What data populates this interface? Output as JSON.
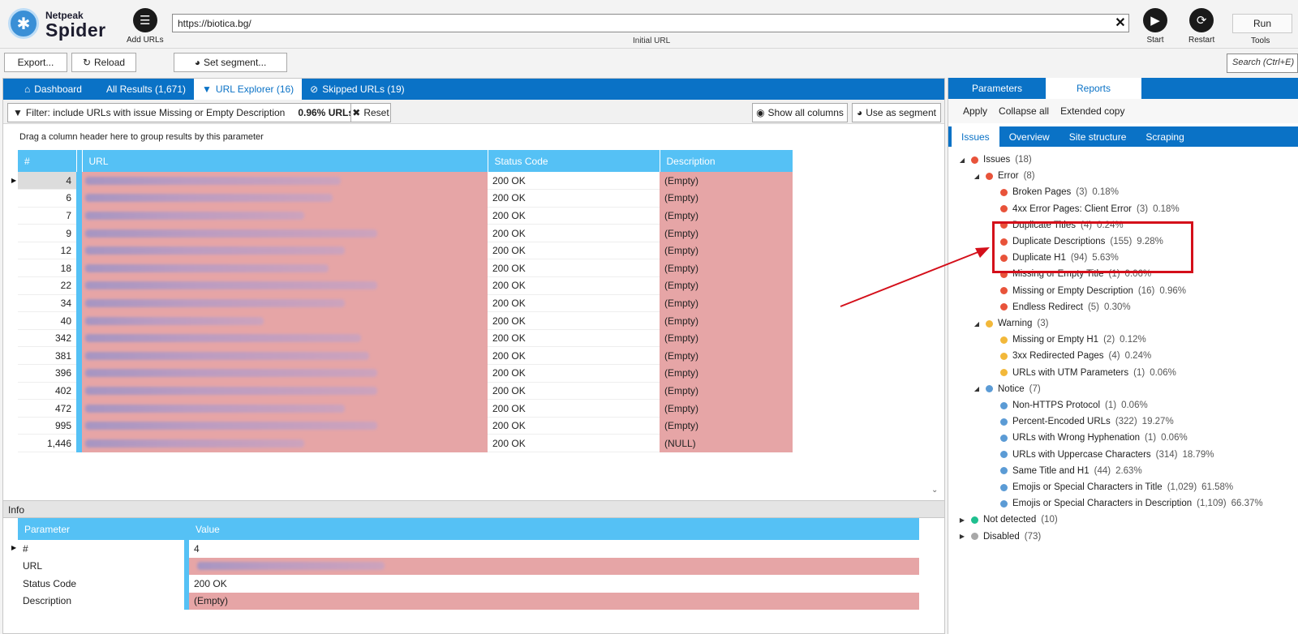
{
  "app": {
    "logo_small": "Netpeak",
    "logo_big": "Spider"
  },
  "toolbar": {
    "add_urls_label": "Add URLs",
    "url_value": "https://biotica.bg/",
    "url_caption": "Initial URL",
    "start_label": "Start",
    "restart_label": "Restart",
    "run_label": "Run",
    "tools_label": "Tools",
    "export_label": "Export...",
    "reload_label": "Reload",
    "segment_label": "Set segment...",
    "search_placeholder": "Search (Ctrl+E)"
  },
  "tabs": {
    "dashboard": "Dashboard",
    "all_results": "All Results (1,671)",
    "url_explorer": "URL Explorer (16)",
    "skipped": "Skipped URLs (19)"
  },
  "filter": {
    "text": "Filter: include URLs with issue Missing or Empty Description",
    "pct": "0.96% URLs",
    "reset_label": "Reset",
    "show_all_columns": "Show all columns",
    "use_as_segment": "Use as segment"
  },
  "grid": {
    "group_hint": "Drag a column header here to group results by this parameter",
    "col_num": "#",
    "col_url": "URL",
    "col_status": "Status Code",
    "col_desc": "Description",
    "rows": [
      {
        "num": "4",
        "status": "200 OK",
        "desc": "(Empty)",
        "w": 0.63
      },
      {
        "num": "6",
        "status": "200 OK",
        "desc": "(Empty)",
        "w": 0.61
      },
      {
        "num": "7",
        "status": "200 OK",
        "desc": "(Empty)",
        "w": 0.54
      },
      {
        "num": "9",
        "status": "200 OK",
        "desc": "(Empty)",
        "w": 0.72
      },
      {
        "num": "12",
        "status": "200 OK",
        "desc": "(Empty)",
        "w": 0.64
      },
      {
        "num": "18",
        "status": "200 OK",
        "desc": "(Empty)",
        "w": 0.6
      },
      {
        "num": "22",
        "status": "200 OK",
        "desc": "(Empty)",
        "w": 0.72
      },
      {
        "num": "34",
        "status": "200 OK",
        "desc": "(Empty)",
        "w": 0.64
      },
      {
        "num": "40",
        "status": "200 OK",
        "desc": "(Empty)",
        "w": 0.44
      },
      {
        "num": "342",
        "status": "200 OK",
        "desc": "(Empty)",
        "w": 0.68
      },
      {
        "num": "381",
        "status": "200 OK",
        "desc": "(Empty)",
        "w": 0.7
      },
      {
        "num": "396",
        "status": "200 OK",
        "desc": "(Empty)",
        "w": 0.72
      },
      {
        "num": "402",
        "status": "200 OK",
        "desc": "(Empty)",
        "w": 0.72
      },
      {
        "num": "472",
        "status": "200 OK",
        "desc": "(Empty)",
        "w": 0.64
      },
      {
        "num": "995",
        "status": "200 OK",
        "desc": "(Empty)",
        "w": 0.72
      },
      {
        "num": "1,446",
        "status": "200 OK",
        "desc": "(NULL)",
        "w": 0.54
      }
    ]
  },
  "info": {
    "title": "Info",
    "col_param": "Parameter",
    "col_value": "Value",
    "rows": [
      {
        "param": "#",
        "value": "4"
      },
      {
        "param": "URL",
        "value": ""
      },
      {
        "param": "Status Code",
        "value": "200 OK"
      },
      {
        "param": "Description",
        "value": "(Empty)"
      }
    ]
  },
  "right": {
    "tab_parameters": "Parameters",
    "tab_reports": "Reports",
    "apply": "Apply",
    "collapse_all": "Collapse all",
    "extended_copy": "Extended copy",
    "subtabs": [
      "Issues",
      "Overview",
      "Site structure",
      "Scraping"
    ],
    "tree": [
      {
        "level": 0,
        "toggle": "◢",
        "color": "#e8533a",
        "label": "Issues",
        "count": "(18)",
        "pct": ""
      },
      {
        "level": 1,
        "toggle": "◢",
        "color": "#e8533a",
        "label": "Error",
        "count": "(8)",
        "pct": ""
      },
      {
        "level": 2,
        "toggle": "",
        "color": "#e8533a",
        "label": "Broken Pages",
        "count": "(3)",
        "pct": "0.18%"
      },
      {
        "level": 2,
        "toggle": "",
        "color": "#e8533a",
        "label": "4xx Error Pages: Client Error",
        "count": "(3)",
        "pct": "0.18%"
      },
      {
        "level": 2,
        "toggle": "",
        "color": "#e8533a",
        "label": "Duplicate Titles",
        "count": "(4)",
        "pct": "0.24%"
      },
      {
        "level": 2,
        "toggle": "",
        "color": "#e8533a",
        "label": "Duplicate Descriptions",
        "count": "(155)",
        "pct": "9.28%"
      },
      {
        "level": 2,
        "toggle": "",
        "color": "#e8533a",
        "label": "Duplicate H1",
        "count": "(94)",
        "pct": "5.63%"
      },
      {
        "level": 2,
        "toggle": "",
        "color": "#e8533a",
        "label": "Missing or Empty Title",
        "count": "(1)",
        "pct": "0.06%"
      },
      {
        "level": 2,
        "toggle": "",
        "color": "#e8533a",
        "label": "Missing or Empty Description",
        "count": "(16)",
        "pct": "0.96%"
      },
      {
        "level": 2,
        "toggle": "",
        "color": "#e8533a",
        "label": "Endless Redirect",
        "count": "(5)",
        "pct": "0.30%"
      },
      {
        "level": 1,
        "toggle": "◢",
        "color": "#f2b83a",
        "label": "Warning",
        "count": "(3)",
        "pct": ""
      },
      {
        "level": 2,
        "toggle": "",
        "color": "#f2b83a",
        "label": "Missing or Empty H1",
        "count": "(2)",
        "pct": "0.12%"
      },
      {
        "level": 2,
        "toggle": "",
        "color": "#f2b83a",
        "label": "3xx Redirected Pages",
        "count": "(4)",
        "pct": "0.24%"
      },
      {
        "level": 2,
        "toggle": "",
        "color": "#f2b83a",
        "label": "URLs with UTM Parameters",
        "count": "(1)",
        "pct": "0.06%"
      },
      {
        "level": 1,
        "toggle": "◢",
        "color": "#5b9bd5",
        "label": "Notice",
        "count": "(7)",
        "pct": ""
      },
      {
        "level": 2,
        "toggle": "",
        "color": "#5b9bd5",
        "label": "Non-HTTPS Protocol",
        "count": "(1)",
        "pct": "0.06%"
      },
      {
        "level": 2,
        "toggle": "",
        "color": "#5b9bd5",
        "label": "Percent-Encoded URLs",
        "count": "(322)",
        "pct": "19.27%"
      },
      {
        "level": 2,
        "toggle": "",
        "color": "#5b9bd5",
        "label": "URLs with Wrong Hyphenation",
        "count": "(1)",
        "pct": "0.06%"
      },
      {
        "level": 2,
        "toggle": "",
        "color": "#5b9bd5",
        "label": "URLs with Uppercase Characters",
        "count": "(314)",
        "pct": "18.79%"
      },
      {
        "level": 2,
        "toggle": "",
        "color": "#5b9bd5",
        "label": "Same Title and H1",
        "count": "(44)",
        "pct": "2.63%"
      },
      {
        "level": 2,
        "toggle": "",
        "color": "#5b9bd5",
        "label": "Emojis or Special Characters in Title",
        "count": "(1,029)",
        "pct": "61.58%"
      },
      {
        "level": 2,
        "toggle": "",
        "color": "#5b9bd5",
        "label": "Emojis or Special Characters in Description",
        "count": "(1,109)",
        "pct": "66.37%"
      },
      {
        "level": 0,
        "toggle": "▶",
        "color": "#1fbf8f",
        "label": "Not detected",
        "count": "(10)",
        "pct": ""
      },
      {
        "level": 0,
        "toggle": "▶",
        "color": "#a8a8a8",
        "label": "Disabled",
        "count": "(73)",
        "pct": ""
      }
    ]
  },
  "colors": {
    "accent": "#0a72c6",
    "header_cyan": "#55c1f5",
    "issue_highlight": "#e6a5a6",
    "annotation_red": "#d40f1a"
  }
}
